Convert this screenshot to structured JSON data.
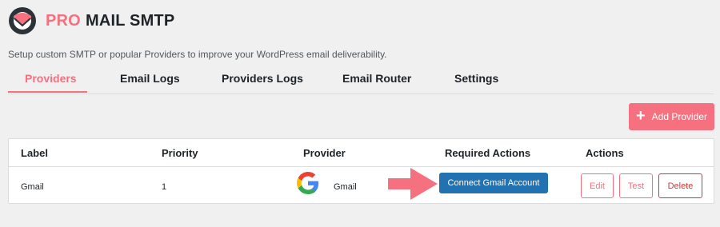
{
  "brand": {
    "pro": "PRO",
    "name": "MAIL SMTP"
  },
  "subtitle": "Setup custom SMTP or popular Providers to improve your WordPress email deliverability.",
  "tabs": [
    {
      "label": "Providers",
      "active": true
    },
    {
      "label": "Email Logs",
      "active": false
    },
    {
      "label": "Providers Logs",
      "active": false
    },
    {
      "label": "Email Router",
      "active": false
    },
    {
      "label": "Settings",
      "active": false
    }
  ],
  "add_provider": {
    "icon": "plus-icon",
    "label": "Add Provider"
  },
  "table": {
    "headers": [
      "Label",
      "Priority",
      "Provider",
      "Required Actions",
      "Actions"
    ],
    "rows": [
      {
        "label": "Gmail",
        "priority": "1",
        "provider_icon": "google-icon",
        "provider": "Gmail",
        "required_action": "Connect Gmail Account",
        "actions": [
          "Edit",
          "Test",
          "Delete"
        ]
      }
    ]
  },
  "colors": {
    "accent": "#f5717f",
    "primary_button": "#2271b1",
    "delete": "#d63638",
    "background": "#f0f0f1"
  }
}
